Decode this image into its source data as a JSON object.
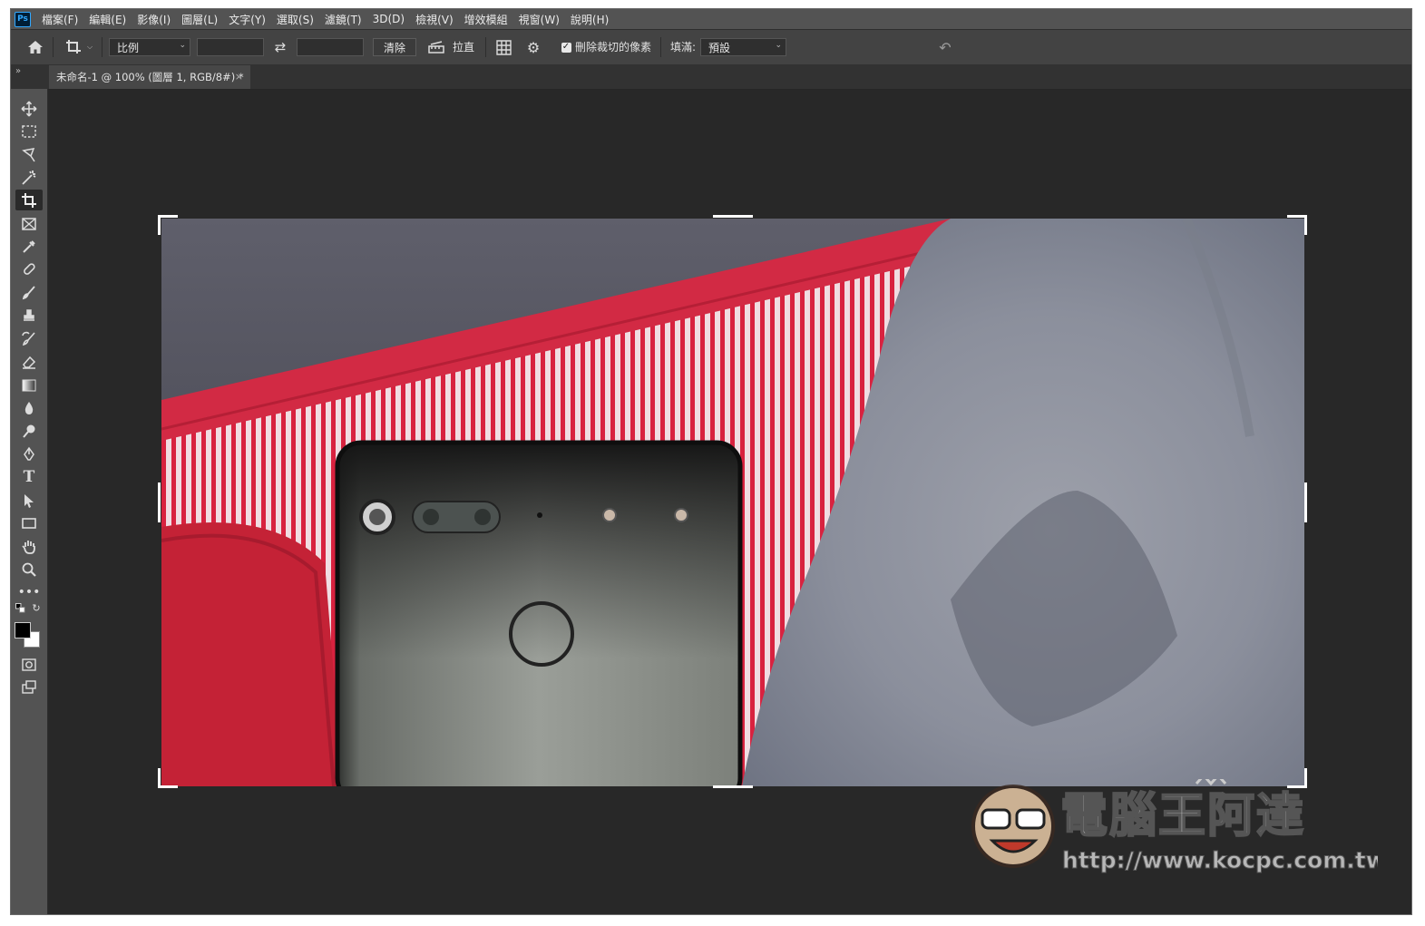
{
  "app": {
    "logo": "Ps"
  },
  "menu": [
    "檔案(F)",
    "編輯(E)",
    "影像(I)",
    "圖層(L)",
    "文字(Y)",
    "選取(S)",
    "濾鏡(T)",
    "3D(D)",
    "檢視(V)",
    "增效模組",
    "視窗(W)",
    "說明(H)"
  ],
  "options_bar": {
    "ratio_select": "比例",
    "clear_button": "清除",
    "straighten_label": "拉直",
    "delete_pixels_label": "刪除裁切的像素",
    "delete_pixels_checked": true,
    "fill_label": "填滿:",
    "fill_select": "預設"
  },
  "document_tab": {
    "title": "未命名-1 @ 100% (圖層 1, RGB/8#) *",
    "close": "×"
  },
  "tools": [
    "move-tool",
    "marquee-tool",
    "lasso-tool",
    "magic-wand-tool",
    "crop-tool",
    "frame-tool",
    "eyedropper-tool",
    "healing-brush-tool",
    "brush-tool",
    "clone-stamp-tool",
    "history-brush-tool",
    "eraser-tool",
    "gradient-tool",
    "blur-tool",
    "dodge-tool",
    "pen-tool",
    "type-tool",
    "path-selection-tool",
    "rectangle-tool",
    "hand-tool",
    "zoom-tool",
    "more-tools"
  ],
  "colors": {
    "foreground": "#000000",
    "background": "#ffffff",
    "chrome": "#535353",
    "canvas": "#282828"
  },
  "watermark": {
    "name": "電腦王阿達",
    "url": "http://www.kocpc.com.tw"
  }
}
